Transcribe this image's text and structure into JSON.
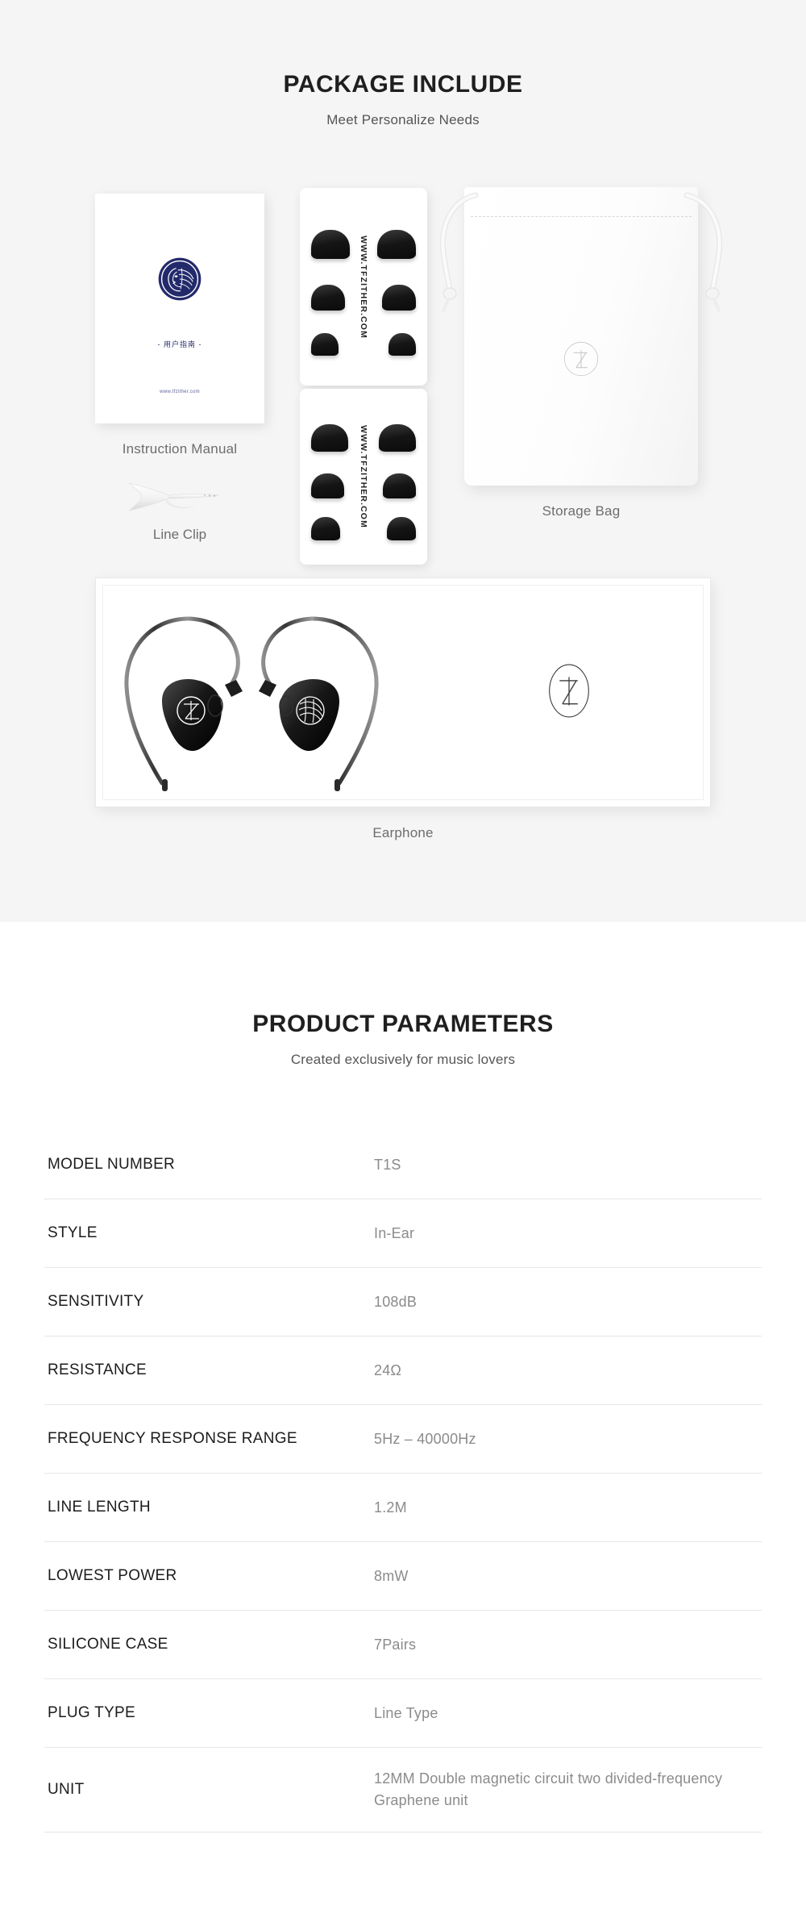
{
  "package": {
    "title": "PACKAGE INCLUDE",
    "subtitle": "Meet Personalize Needs",
    "items": {
      "manual": {
        "caption": "Instruction Manual",
        "cover_cn_text": "- 用户指南 -",
        "cover_url": "www.tfzither.com",
        "logo_color": "#232a6b"
      },
      "line_clip": {
        "caption": "Line Clip"
      },
      "ear_tips": {
        "card_url": "WWW.TFZITHER.COM",
        "cards": 2,
        "tips_per_card": 6
      },
      "storage_bag": {
        "caption": "Storage Bag",
        "logo": "TFZ"
      },
      "earphone": {
        "caption": "Earphone",
        "logo": "TFZ"
      }
    }
  },
  "parameters": {
    "title": "PRODUCT PARAMETERS",
    "subtitle": "Created exclusively for music lovers",
    "specs": [
      {
        "label": "MODEL NUMBER",
        "value": "T1S"
      },
      {
        "label": "STYLE",
        "value": "In-Ear"
      },
      {
        "label": "SENSITIVITY",
        "value": "108dB"
      },
      {
        "label": "RESISTANCE",
        "value": "24Ω"
      },
      {
        "label": "FREQUENCY RESPONSE RANGE",
        "value": "5Hz – 40000Hz"
      },
      {
        "label": "LINE LENGTH",
        "value": "1.2M"
      },
      {
        "label": "LOWEST POWER",
        "value": "8mW"
      },
      {
        "label": "SILICONE CASE",
        "value": "7Pairs"
      },
      {
        "label": "PLUG TYPE",
        "value": "Line Type"
      },
      {
        "label": "UNIT",
        "value": "12MM Double magnetic circuit two divided-frequency Graphene unit"
      }
    ]
  },
  "colors": {
    "section_background": "#f5f5f5",
    "page_background": "#ffffff",
    "heading": "#1f1f1f",
    "caption": "#6d6d6d",
    "spec_label": "#1c1c1c",
    "spec_value": "#8b8b8b",
    "divider": "#e6e6e6",
    "logo_navy": "#232a6b"
  }
}
